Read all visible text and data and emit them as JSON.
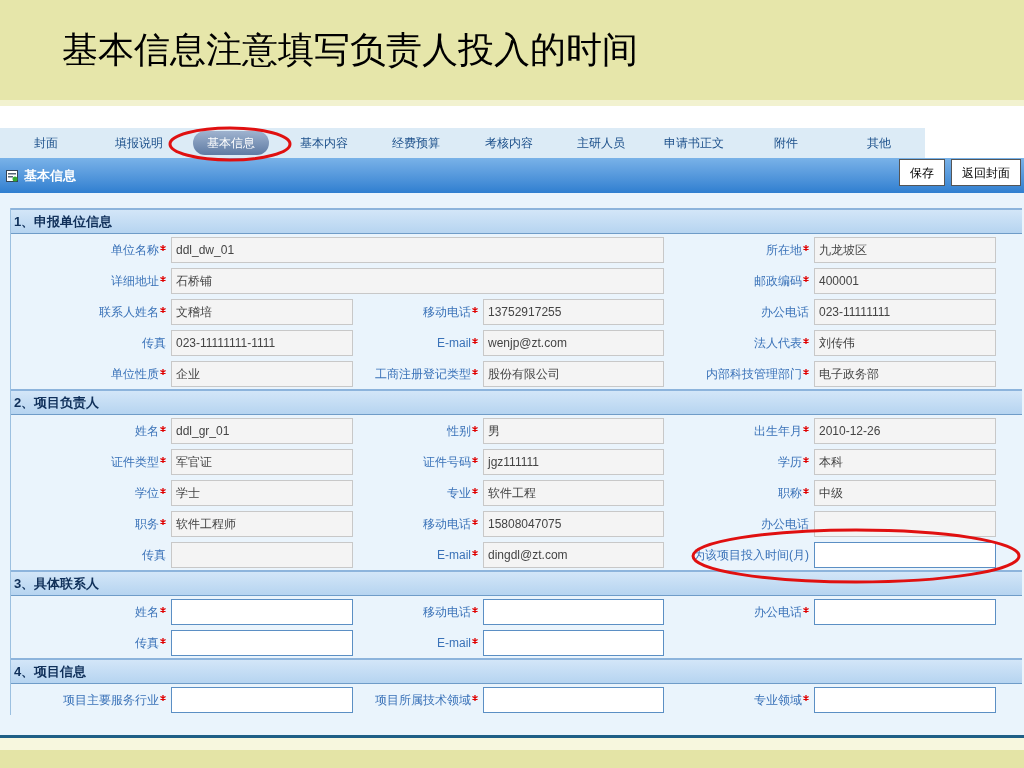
{
  "slide_title": "基本信息注意填写负责人投入的时间",
  "tabs": [
    {
      "label": "封面",
      "selected": false
    },
    {
      "label": "填报说明",
      "selected": false
    },
    {
      "label": "基本信息",
      "selected": true
    },
    {
      "label": "基本内容",
      "selected": false
    },
    {
      "label": "经费预算",
      "selected": false
    },
    {
      "label": "考核内容",
      "selected": false
    },
    {
      "label": "主研人员",
      "selected": false
    },
    {
      "label": "申请书正文",
      "selected": false
    },
    {
      "label": "附件",
      "selected": false
    },
    {
      "label": "其他",
      "selected": false
    }
  ],
  "panel": {
    "title": "基本信息",
    "buttons": [
      "保存",
      "返回封面"
    ]
  },
  "sections": [
    {
      "title": "1、申报单位信息",
      "rows": [
        [
          {
            "label": "单位名称",
            "required": true,
            "value": "ddl_dw_01",
            "wide": true,
            "editable": false
          },
          {
            "label": "所在地",
            "required": true,
            "value": "九龙坡区",
            "wide": false,
            "editable": false
          }
        ],
        [
          {
            "label": "详细地址",
            "required": true,
            "value": "石桥铺",
            "wide": true,
            "editable": false
          },
          {
            "label": "邮政编码",
            "required": true,
            "value": "400001",
            "wide": false,
            "editable": false
          }
        ],
        [
          {
            "label": "联系人姓名",
            "required": true,
            "value": "文稽培",
            "wide": false,
            "editable": false
          },
          {
            "label": "移动电话",
            "required": true,
            "value": "13752917255",
            "wide": false,
            "editable": false
          },
          {
            "label": "办公电话",
            "required": false,
            "value": "023-11111111",
            "wide": false,
            "editable": false
          }
        ],
        [
          {
            "label": "传真",
            "required": false,
            "value": "023-11111111-1111",
            "wide": false,
            "editable": false
          },
          {
            "label": "E-mail",
            "required": true,
            "value": "wenjp@zt.com",
            "wide": false,
            "editable": false
          },
          {
            "label": "法人代表",
            "required": true,
            "value": "刘传伟",
            "wide": false,
            "editable": false
          }
        ],
        [
          {
            "label": "单位性质",
            "required": true,
            "value": "企业",
            "wide": false,
            "editable": false
          },
          {
            "label": "工商注册登记类型",
            "required": true,
            "value": "股份有限公司",
            "wide": false,
            "editable": false
          },
          {
            "label": "内部科技管理部门",
            "required": true,
            "value": "电子政务部",
            "wide": false,
            "editable": false
          }
        ]
      ]
    },
    {
      "title": "2、项目负责人",
      "rows": [
        [
          {
            "label": "姓名",
            "required": true,
            "value": "ddl_gr_01",
            "wide": false,
            "editable": false
          },
          {
            "label": "性别",
            "required": true,
            "value": "男",
            "wide": false,
            "editable": false
          },
          {
            "label": "出生年月",
            "required": true,
            "value": "2010-12-26",
            "wide": false,
            "editable": false
          }
        ],
        [
          {
            "label": "证件类型",
            "required": true,
            "value": "军官证",
            "wide": false,
            "editable": false
          },
          {
            "label": "证件号码",
            "required": true,
            "value": "jgz111111",
            "wide": false,
            "editable": false
          },
          {
            "label": "学历",
            "required": true,
            "value": "本科",
            "wide": false,
            "editable": false
          }
        ],
        [
          {
            "label": "学位",
            "required": true,
            "value": "学士",
            "wide": false,
            "editable": false
          },
          {
            "label": "专业",
            "required": true,
            "value": "软件工程",
            "wide": false,
            "editable": false
          },
          {
            "label": "职称",
            "required": true,
            "value": "中级",
            "wide": false,
            "editable": false
          }
        ],
        [
          {
            "label": "职务",
            "required": true,
            "value": "软件工程师",
            "wide": false,
            "editable": false
          },
          {
            "label": "移动电话",
            "required": true,
            "value": "15808047075",
            "wide": false,
            "editable": false
          },
          {
            "label": "办公电话",
            "required": false,
            "wide": false,
            "editable": false
          }
        ],
        [
          {
            "label": "传真",
            "required": false,
            "wide": false,
            "editable": false
          },
          {
            "label": "E-mail",
            "required": true,
            "value": "dingdl@zt.com",
            "wide": false,
            "editable": false
          },
          {
            "label": "为该项目投入时间(月)",
            "required": false,
            "wide": false,
            "editable": true
          }
        ]
      ]
    },
    {
      "title": "3、具体联系人",
      "rows": [
        [
          {
            "label": "姓名",
            "required": true,
            "wide": false,
            "editable": true
          },
          {
            "label": "移动电话",
            "required": true,
            "wide": false,
            "editable": true
          },
          {
            "label": "办公电话",
            "required": true,
            "wide": false,
            "editable": true
          }
        ],
        [
          {
            "label": "传真",
            "required": true,
            "wide": false,
            "editable": true
          },
          {
            "label": "E-mail",
            "required": true,
            "wide": false,
            "editable": true
          }
        ]
      ]
    },
    {
      "title": "4、项目信息",
      "rows": [
        [
          {
            "label": "项目主要服务行业",
            "required": true,
            "wide": false,
            "editable": true
          },
          {
            "label": "项目所属技术领域",
            "required": true,
            "wide": false,
            "editable": true
          },
          {
            "label": "专业领域",
            "required": true,
            "wide": false,
            "editable": true
          }
        ]
      ]
    }
  ]
}
